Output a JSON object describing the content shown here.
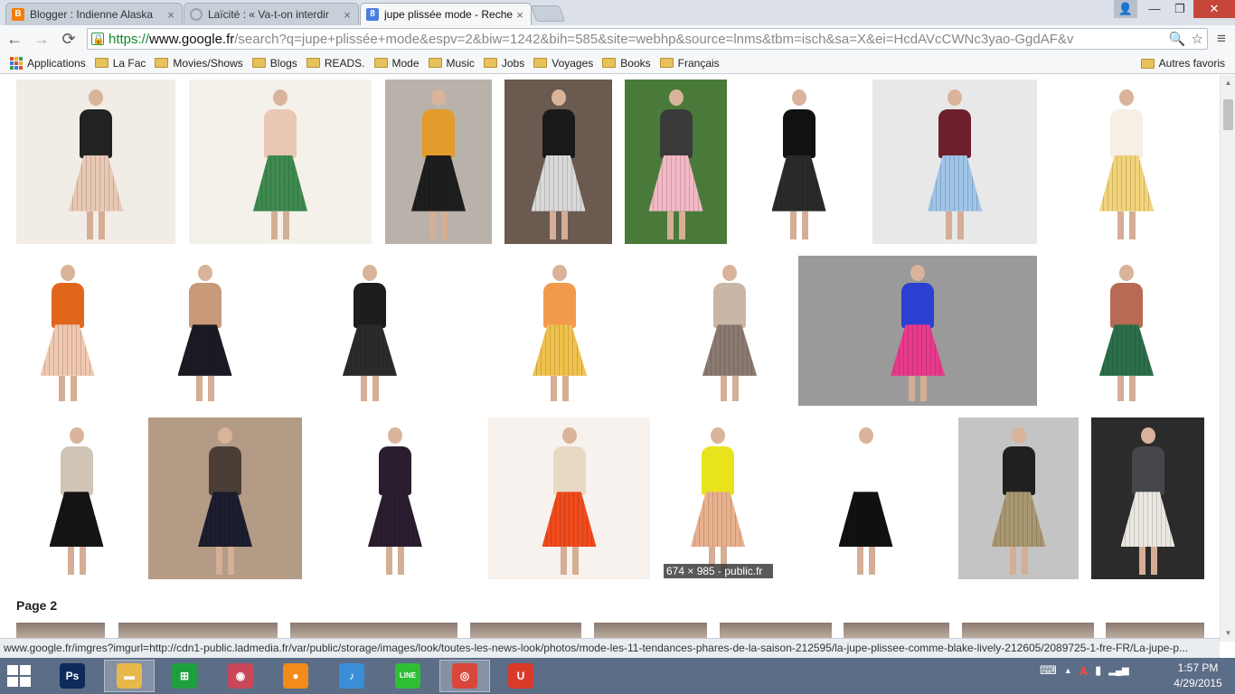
{
  "tabs": [
    {
      "title": "Blogger : Indienne Alaska",
      "favicon": "blogger-icon",
      "color": "#f57d00",
      "glyph": "B",
      "active": false
    },
    {
      "title": "Laïcité : « Va-t-on interdir",
      "favicon": "loading-icon",
      "color": "#9aa4b0",
      "glyph": "",
      "active": false
    },
    {
      "title": "jupe plissée mode - Reche",
      "favicon": "google-icon",
      "color": "#4a7fe0",
      "glyph": "8",
      "active": true
    }
  ],
  "window_controls": {
    "minimize": "—",
    "maximize": "❐",
    "close": "✕",
    "user": "👤"
  },
  "toolbar": {
    "back": "←",
    "forward": "→",
    "reload": "⟳",
    "menu": "≡",
    "url_scheme": "https://",
    "url_host": "www.google.fr",
    "url_path": "/search?q=jupe+plissée+mode&espv=2&biw=1242&bih=585&site=webhp&source=lnms&tbm=isch&sa=X&ei=HcdAVcCWNc3yao-GgdAF&v",
    "zoom_icon": "🔍",
    "star_icon": "☆"
  },
  "bookmarks": [
    {
      "label": "Applications",
      "type": "apps"
    },
    {
      "label": "La Fac",
      "type": "folder"
    },
    {
      "label": "Movies/Shows",
      "type": "folder"
    },
    {
      "label": "Blogs",
      "type": "folder"
    },
    {
      "label": "READS.",
      "type": "folder"
    },
    {
      "label": "Mode",
      "type": "folder"
    },
    {
      "label": "Music",
      "type": "folder"
    },
    {
      "label": "Jobs",
      "type": "folder"
    },
    {
      "label": "Voyages",
      "type": "folder"
    },
    {
      "label": "Books",
      "type": "folder"
    },
    {
      "label": "Français",
      "type": "folder"
    }
  ],
  "bookmarks_right": "Autres favoris",
  "results": {
    "hover_caption": "674 × 985 - public.fr",
    "page2_label": "Page 2",
    "images": [
      {
        "bg": "#f2ece6",
        "skirt": "#e8c9b4",
        "top": "#222222"
      },
      {
        "bg": "#f4f1ea",
        "skirt": "#3e8a4f",
        "top": "#e9c7b2"
      },
      {
        "bg": "#b8b2aa",
        "skirt": "#1e1e1e",
        "top": "#e39b2c"
      },
      {
        "bg": "#6a5a50",
        "skirt": "#d8d8d8",
        "top": "#1a1a1a"
      },
      {
        "bg": "#4a7a3a",
        "skirt": "#f2b8c6",
        "top": "#3a3a3a"
      },
      {
        "bg": "#ffffff",
        "skirt": "#2a2a2a",
        "top": "#111111"
      },
      {
        "bg": "#e8e8e8",
        "skirt": "#9ec4e8",
        "top": "#6d1f2b"
      },
      {
        "bg": "#ffffff",
        "skirt": "#f2d37a",
        "top": "#f5efe4"
      },
      {
        "bg": "#ffffff",
        "skirt": "#f0c8b0",
        "top": "#e0661c"
      },
      {
        "bg": "#ffffff",
        "skirt": "#1b1b24",
        "top": "#c99a7a"
      },
      {
        "bg": "#ffffff",
        "skirt": "#2b2b2b",
        "top": "#1d1d1d"
      },
      {
        "bg": "#ffffff",
        "skirt": "#f0c24d",
        "top": "#f29a4c"
      },
      {
        "bg": "#ffffff",
        "skirt": "#8a7a70",
        "top": "#c9b6a6"
      },
      {
        "bg": "#9a9a9a",
        "skirt": "#e83a8c",
        "top": "#2b3fd1"
      },
      {
        "bg": "#ffffff",
        "skirt": "#2b6e4a",
        "top": "#b86a54"
      },
      {
        "bg": "#ffffff",
        "skirt": "#151515",
        "top": "#cfc4b6"
      },
      {
        "bg": "#b49b86",
        "skirt": "#1c1d2e",
        "top": "#4b3e36"
      },
      {
        "bg": "#ffffff",
        "skirt": "#2a1d2f",
        "top": "#2a1d2f"
      },
      {
        "bg": "#f7f2ee",
        "skirt": "#f04b1c",
        "top": "#e8d9c4"
      },
      {
        "bg": "#ffffff",
        "skirt": "#e9b08e",
        "top": "#e8e31d"
      },
      {
        "bg": "#ffffff",
        "skirt": "#111111",
        "top": "#ffffff"
      },
      {
        "bg": "#c4c4c4",
        "skirt": "#a89770",
        "top": "#202020"
      },
      {
        "bg": "#2b2b2b",
        "skirt": "#eae7e0",
        "top": "#46474d"
      }
    ]
  },
  "status_url": "www.google.fr/imgres?imgurl=http://cdn1-public.ladmedia.fr/var/public/storage/images/look/toutes-les-news-look/photos/mode-les-11-tendances-phares-de-la-saison-212595/la-jupe-plissee-comme-blake-lively-212605/2089725-1-fre-FR/La-jupe-p...",
  "taskbar": {
    "apps": [
      {
        "name": "photoshop",
        "glyph": "Ps",
        "color": "#0d2a5a"
      },
      {
        "name": "file-explorer",
        "glyph": "▬",
        "color": "#e8b84a"
      },
      {
        "name": "store",
        "glyph": "⊞",
        "color": "#1e9f3d"
      },
      {
        "name": "picasa",
        "glyph": "◉",
        "color": "#c9475a"
      },
      {
        "name": "pidgin",
        "glyph": "●",
        "color": "#f28a1c"
      },
      {
        "name": "itunes",
        "glyph": "♪",
        "color": "#3a8ed8"
      },
      {
        "name": "line",
        "glyph": "LINE",
        "color": "#2fbf35"
      },
      {
        "name": "chrome",
        "glyph": "◎",
        "color": "#d9463a"
      },
      {
        "name": "app-u",
        "glyph": "U",
        "color": "#d93a2a"
      }
    ],
    "time": "1:57 PM",
    "date": "4/29/2015",
    "tray_keyboard": "⌨",
    "tray_arrow": "▲",
    "tray_acrobat": "A",
    "tray_battery": "▮",
    "tray_signal": "▂▄▆"
  }
}
